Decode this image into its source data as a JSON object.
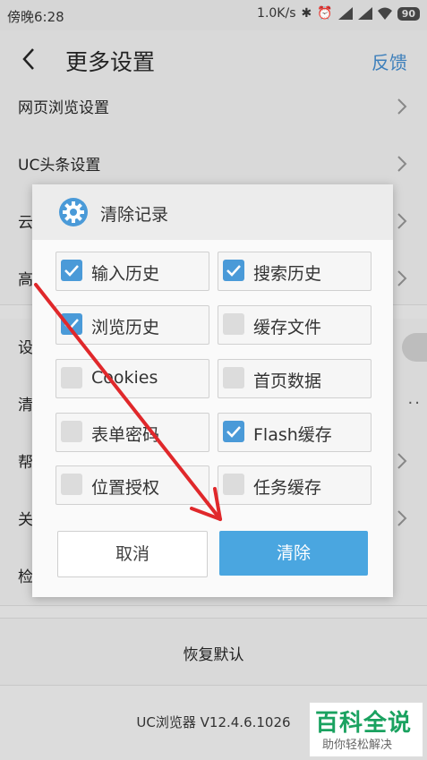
{
  "status_bar": {
    "time": "傍晚6:28",
    "speed": "1.0K/s",
    "battery": "90"
  },
  "header": {
    "title": "更多设置",
    "feedback_label": "反馈"
  },
  "settings_rows": [
    {
      "label": "网页浏览设置"
    },
    {
      "label": "UC头条设置"
    },
    {
      "label": "云"
    },
    {
      "label": "高"
    },
    {
      "label": "设"
    },
    {
      "label": "清"
    },
    {
      "label": "帮"
    },
    {
      "label": "关"
    },
    {
      "label": "检"
    }
  ],
  "restore_label": "恢复默认",
  "version": "UC浏览器 V12.4.6.1026",
  "dialog": {
    "title": "清除记录",
    "options": [
      {
        "label": "输入历史",
        "checked": true
      },
      {
        "label": "搜索历史",
        "checked": true
      },
      {
        "label": "浏览历史",
        "checked": true
      },
      {
        "label": "缓存文件",
        "checked": false
      },
      {
        "label": "Cookies",
        "checked": false
      },
      {
        "label": "首页数据",
        "checked": false
      },
      {
        "label": "表单密码",
        "checked": false
      },
      {
        "label": "Flash缓存",
        "checked": true
      },
      {
        "label": "位置授权",
        "checked": false
      },
      {
        "label": "任务缓存",
        "checked": false
      }
    ],
    "cancel_label": "取消",
    "clear_label": "清除"
  },
  "watermark": {
    "main": "百科全说",
    "sub": "助你轻松解决"
  },
  "colors": {
    "accent": "#4aa6e0",
    "checkbox_checked": "#4a9ad8",
    "feedback_link": "#3d7fbb",
    "annotation_arrow": "#e0282b"
  }
}
